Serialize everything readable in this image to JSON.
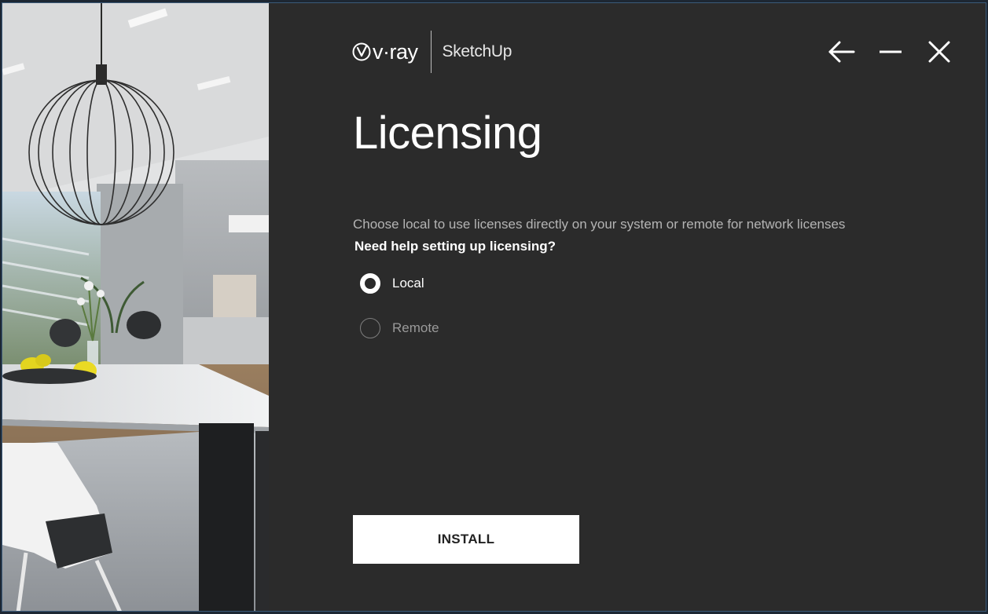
{
  "window": {
    "brand": "v·ray",
    "product": "SketchUp",
    "controls": {
      "back_icon": "arrow-left-icon",
      "minimize_icon": "minimize-icon",
      "close_icon": "close-icon"
    }
  },
  "page": {
    "title": "Licensing",
    "description": "Choose local to use licenses directly on your system or remote for network licenses",
    "help_link": "Need help setting up licensing?"
  },
  "license_options": {
    "selected": "Local",
    "items": [
      {
        "label": "Local",
        "checked": true
      },
      {
        "label": "Remote",
        "checked": false
      }
    ]
  },
  "actions": {
    "install_label": "INSTALL"
  },
  "colors": {
    "panel_bg": "#2b2b2b",
    "text_primary": "#ffffff",
    "text_secondary": "#b4b4b4",
    "button_bg": "#ffffff",
    "button_text": "#222222"
  }
}
